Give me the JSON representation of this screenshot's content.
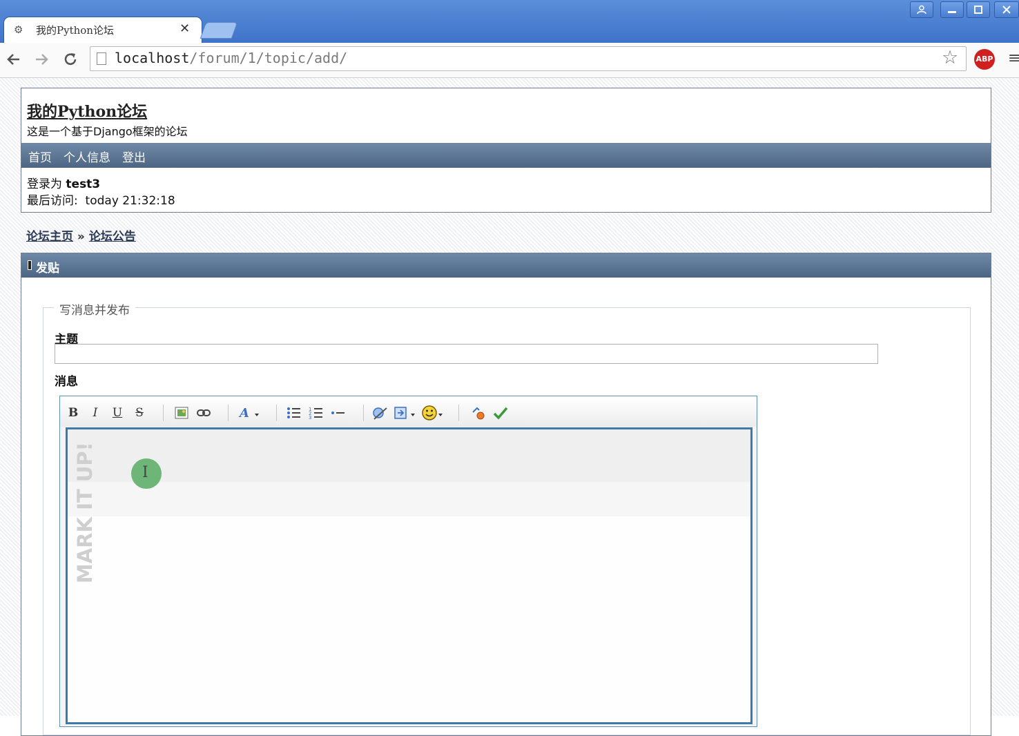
{
  "browser": {
    "tab_title": "我的Python论坛",
    "tab_close": "✕",
    "url_host": "localhost",
    "url_path": "/forum/1/topic/add/",
    "abp_label": "ABP",
    "icons": {
      "back": "back-arrow-icon",
      "forward": "forward-arrow-icon",
      "reload": "reload-icon",
      "bookmark": "star-icon",
      "menu": "hamburger-menu-icon"
    },
    "colors": {
      "titlebar": "#3f73c9",
      "abp": "#d01f1f"
    }
  },
  "site": {
    "title": "我的Python论坛",
    "subtitle": "这是一个基于Django框架的论坛",
    "nav": [
      "首页",
      "个人信息",
      "登出"
    ],
    "login_prefix": "登录为",
    "username": "test3",
    "last_visit_label": "最后访问:",
    "last_visit_value": "today 21:32:18"
  },
  "breadcrumb": {
    "home": "论坛主页",
    "separator": "»",
    "current": "论坛公告"
  },
  "post": {
    "header": "发贴",
    "legend": "写消息并发布",
    "subject_label": "主题",
    "subject_value": "",
    "message_label": "消息",
    "editor_watermark": "MARK IT UP!",
    "toolbar": {
      "bold": "B",
      "italic": "I",
      "underline": "U",
      "strike": "S"
    },
    "colors": {
      "header": "#4c6584",
      "editor_border": "#3d7aa9"
    }
  }
}
